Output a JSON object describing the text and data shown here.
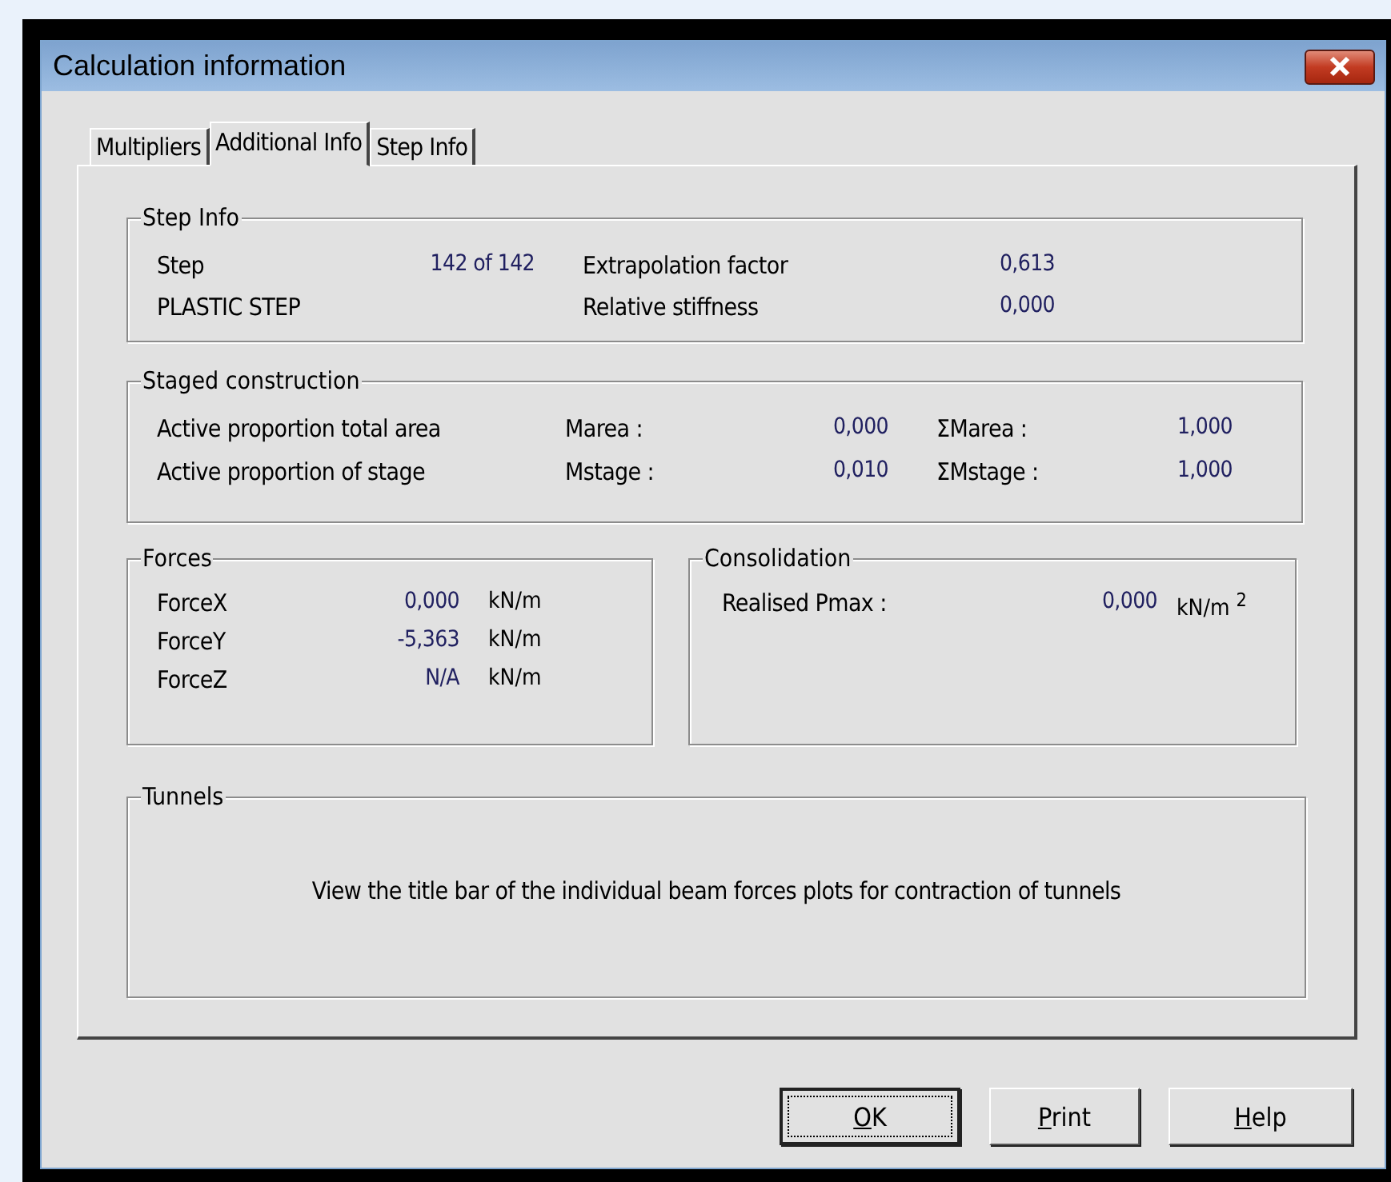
{
  "window": {
    "title": "Calculation information"
  },
  "tabs": [
    {
      "label": "Multipliers",
      "selected": false
    },
    {
      "label": "Additional Info",
      "selected": true
    },
    {
      "label": "Step Info",
      "selected": false
    }
  ],
  "step_info": {
    "title": "Step Info",
    "rows": [
      {
        "label": "Step",
        "value": "142 of 142",
        "label_2": "Extrapolation factor",
        "value_2": "0,613"
      },
      {
        "label": "PLASTIC STEP",
        "label_2": "Relative stiffness",
        "value_2": "0,000"
      }
    ]
  },
  "staged_construction": {
    "title": "Staged construction",
    "rows": [
      {
        "label": "Active proportion total area",
        "m_label": "Marea :",
        "m_value": "0,000",
        "sum_label": "ΣMarea :",
        "sum_value": "1,000"
      },
      {
        "label": "Active proportion of stage",
        "m_label": "Mstage :",
        "m_value": "0,010",
        "sum_label": "ΣMstage :",
        "sum_value": "1,000"
      }
    ]
  },
  "forces": {
    "title": "Forces",
    "rows": [
      {
        "label": "ForceX",
        "value": "0,000",
        "unit": "kN/m"
      },
      {
        "label": "ForceY",
        "value": "-5,363",
        "unit": "kN/m"
      },
      {
        "label": "ForceZ",
        "value": "N/A",
        "unit": "kN/m"
      }
    ]
  },
  "consolidation": {
    "title": "Consolidation",
    "rows": [
      {
        "label": "Realised Pmax :",
        "value": "0,000",
        "unit": "kN/m $^{2}$"
      }
    ]
  },
  "tunnels": {
    "title": "Tunnels",
    "message": "View the title bar of the individual beam forces plots for contraction of tunnels"
  },
  "buttons": [
    {
      "label": "OK",
      "first_letter_underlined": true,
      "default": true
    },
    {
      "label": "Print",
      "first_letter_underlined": true,
      "default": false
    },
    {
      "label": "Help",
      "first_letter_underlined": true,
      "default": false
    }
  ]
}
